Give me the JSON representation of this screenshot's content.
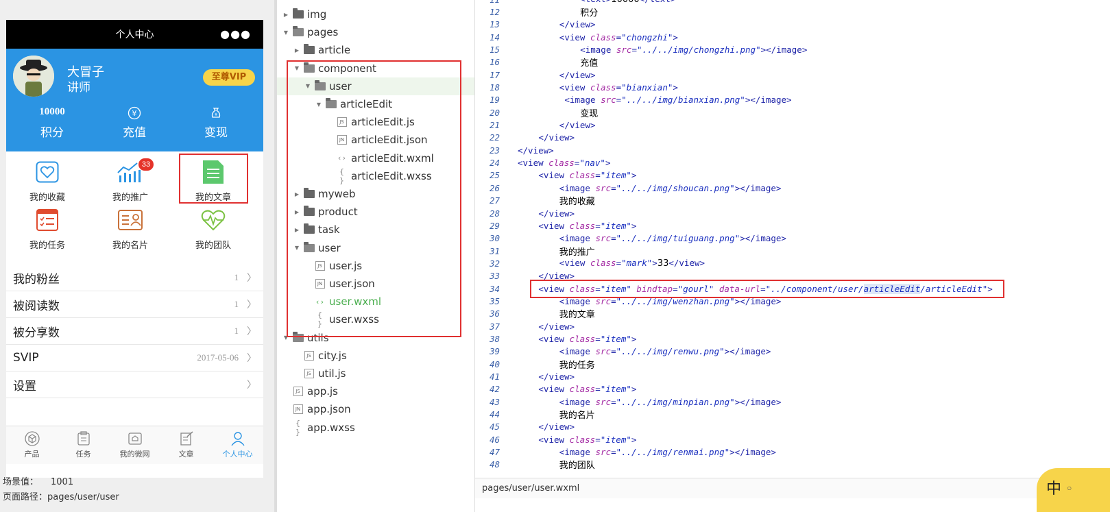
{
  "simulator": {
    "nav_title": "个人中心",
    "menu_dots": "●●●",
    "user": {
      "name": "大冒子",
      "role": "讲师",
      "vip_badge": "至尊VIP"
    },
    "stats": [
      {
        "value": "10000",
        "label": "积分",
        "icon": "points"
      },
      {
        "value": "",
        "label": "充值",
        "icon": "yen-circle-icon"
      },
      {
        "value": "",
        "label": "变现",
        "icon": "money-bag-icon"
      }
    ],
    "grid": [
      {
        "label": "我的收藏",
        "icon": "heart-icon"
      },
      {
        "label": "我的推广",
        "icon": "bar-chart-icon",
        "badge": "33"
      },
      {
        "label": "我的文章",
        "icon": "document-icon"
      },
      {
        "label": "我的任务",
        "icon": "checklist-icon"
      },
      {
        "label": "我的名片",
        "icon": "id-card-icon"
      },
      {
        "label": "我的团队",
        "icon": "heartbeat-icon"
      }
    ],
    "list": [
      {
        "label": "我的粉丝",
        "value": "1"
      },
      {
        "label": "被阅读数",
        "value": "1"
      },
      {
        "label": "被分享数",
        "value": "1"
      },
      {
        "label": "SVIP",
        "value": "2017-05-06"
      },
      {
        "label": "设置",
        "value": ""
      }
    ],
    "tabs": [
      {
        "label": "产品",
        "icon": "cube-icon"
      },
      {
        "label": "任务",
        "icon": "task-icon"
      },
      {
        "label": "我的微网",
        "icon": "home-icon"
      },
      {
        "label": "文章",
        "icon": "edit-doc-icon"
      },
      {
        "label": "个人中心",
        "icon": "person-icon",
        "active": true
      }
    ],
    "scene_label": "场景值：",
    "scene_value": "1001",
    "page_path": "页面路径：pages/user/user"
  },
  "tree": [
    {
      "name": "img",
      "type": "folder",
      "depth": 0,
      "open": false
    },
    {
      "name": "pages",
      "type": "folder",
      "depth": 0,
      "open": true
    },
    {
      "name": "article",
      "type": "folder",
      "depth": 1,
      "open": false
    },
    {
      "name": "component",
      "type": "folder",
      "depth": 1,
      "open": true
    },
    {
      "name": "user",
      "type": "folder",
      "depth": 2,
      "open": true,
      "selected": true
    },
    {
      "name": "articleEdit",
      "type": "folder",
      "depth": 3,
      "open": true
    },
    {
      "name": "articleEdit.js",
      "type": "js",
      "depth": 4
    },
    {
      "name": "articleEdit.json",
      "type": "json",
      "depth": 4
    },
    {
      "name": "articleEdit.wxml",
      "type": "wxml",
      "depth": 4
    },
    {
      "name": "articleEdit.wxss",
      "type": "wxss",
      "depth": 4
    },
    {
      "name": "myweb",
      "type": "folder",
      "depth": 1,
      "open": false
    },
    {
      "name": "product",
      "type": "folder",
      "depth": 1,
      "open": false
    },
    {
      "name": "task",
      "type": "folder",
      "depth": 1,
      "open": false
    },
    {
      "name": "user",
      "type": "folder",
      "depth": 1,
      "open": true
    },
    {
      "name": "user.js",
      "type": "js",
      "depth": 2
    },
    {
      "name": "user.json",
      "type": "json",
      "depth": 2
    },
    {
      "name": "user.wxml",
      "type": "wxml",
      "depth": 2,
      "active": true
    },
    {
      "name": "user.wxss",
      "type": "wxss",
      "depth": 2
    },
    {
      "name": "utils",
      "type": "folder",
      "depth": 0,
      "open": true
    },
    {
      "name": "city.js",
      "type": "js",
      "depth": 1
    },
    {
      "name": "util.js",
      "type": "js",
      "depth": 1
    },
    {
      "name": "app.js",
      "type": "js",
      "depth": 0
    },
    {
      "name": "app.json",
      "type": "json",
      "depth": 0
    },
    {
      "name": "app.wxss",
      "type": "wxss",
      "depth": 0
    }
  ],
  "editor": {
    "status_path": "pages/user/user.wxml",
    "lines": [
      {
        "n": "11",
        "indent": 12,
        "parts": [
          [
            "tag",
            "<text>"
          ],
          [
            "text",
            "10000"
          ],
          [
            "tag",
            "</text>"
          ]
        ]
      },
      {
        "n": "12",
        "indent": 12,
        "parts": [
          [
            "text",
            "积分"
          ]
        ]
      },
      {
        "n": "13",
        "indent": 8,
        "parts": [
          [
            "tag",
            "</view>"
          ]
        ]
      },
      {
        "n": "14",
        "indent": 8,
        "parts": [
          [
            "tag",
            "<view "
          ],
          [
            "attr",
            "class"
          ],
          [
            "tag",
            "="
          ],
          [
            "str",
            "\"chongzhi\""
          ],
          [
            "tag",
            ">"
          ]
        ]
      },
      {
        "n": "15",
        "indent": 12,
        "parts": [
          [
            "tag",
            "<image "
          ],
          [
            "attr",
            "src"
          ],
          [
            "tag",
            "="
          ],
          [
            "str",
            "\"../../img/chongzhi.png\""
          ],
          [
            "tag",
            "></image>"
          ]
        ]
      },
      {
        "n": "16",
        "indent": 12,
        "parts": [
          [
            "text",
            "充值"
          ]
        ]
      },
      {
        "n": "17",
        "indent": 8,
        "parts": [
          [
            "tag",
            "</view>"
          ]
        ]
      },
      {
        "n": "18",
        "indent": 8,
        "parts": [
          [
            "tag",
            "<view "
          ],
          [
            "attr",
            "class"
          ],
          [
            "tag",
            "="
          ],
          [
            "str",
            "\"bianxian\""
          ],
          [
            "tag",
            ">"
          ]
        ]
      },
      {
        "n": "19",
        "indent": 9,
        "parts": [
          [
            "tag",
            "<image "
          ],
          [
            "attr",
            "src"
          ],
          [
            "tag",
            "="
          ],
          [
            "str",
            "\"../../img/bianxian.png\""
          ],
          [
            "tag",
            "></image>"
          ]
        ]
      },
      {
        "n": "20",
        "indent": 12,
        "parts": [
          [
            "text",
            "变现"
          ]
        ]
      },
      {
        "n": "21",
        "indent": 8,
        "parts": [
          [
            "tag",
            "</view>"
          ]
        ]
      },
      {
        "n": "22",
        "indent": 4,
        "parts": [
          [
            "tag",
            "</view>"
          ]
        ]
      },
      {
        "n": "23",
        "indent": 0,
        "parts": [
          [
            "tag",
            "</view>"
          ]
        ]
      },
      {
        "n": "24",
        "indent": 0,
        "parts": [
          [
            "tag",
            "<view "
          ],
          [
            "attr",
            "class"
          ],
          [
            "tag",
            "="
          ],
          [
            "str",
            "\"nav\""
          ],
          [
            "tag",
            ">"
          ]
        ]
      },
      {
        "n": "25",
        "indent": 4,
        "parts": [
          [
            "tag",
            "<view "
          ],
          [
            "attr",
            "class"
          ],
          [
            "tag",
            "="
          ],
          [
            "str",
            "\"item\""
          ],
          [
            "tag",
            ">"
          ]
        ]
      },
      {
        "n": "26",
        "indent": 8,
        "parts": [
          [
            "tag",
            "<image "
          ],
          [
            "attr",
            "src"
          ],
          [
            "tag",
            "="
          ],
          [
            "str",
            "\"../../img/shoucan.png\""
          ],
          [
            "tag",
            "></image>"
          ]
        ]
      },
      {
        "n": "27",
        "indent": 8,
        "parts": [
          [
            "text",
            "我的收藏"
          ]
        ]
      },
      {
        "n": "28",
        "indent": 4,
        "parts": [
          [
            "tag",
            "</view>"
          ]
        ]
      },
      {
        "n": "29",
        "indent": 4,
        "parts": [
          [
            "tag",
            "<view "
          ],
          [
            "attr",
            "class"
          ],
          [
            "tag",
            "="
          ],
          [
            "str",
            "\"item\""
          ],
          [
            "tag",
            ">"
          ]
        ]
      },
      {
        "n": "30",
        "indent": 8,
        "parts": [
          [
            "tag",
            "<image "
          ],
          [
            "attr",
            "src"
          ],
          [
            "tag",
            "="
          ],
          [
            "str",
            "\"../../img/tuiguang.png\""
          ],
          [
            "tag",
            "></image>"
          ]
        ]
      },
      {
        "n": "31",
        "indent": 8,
        "parts": [
          [
            "text",
            "我的推广"
          ]
        ]
      },
      {
        "n": "32",
        "indent": 8,
        "parts": [
          [
            "tag",
            "<view "
          ],
          [
            "attr",
            "class"
          ],
          [
            "tag",
            "="
          ],
          [
            "str",
            "\"mark\""
          ],
          [
            "tag",
            ">"
          ],
          [
            "text",
            "33"
          ],
          [
            "tag",
            "</view>"
          ]
        ]
      },
      {
        "n": "33",
        "indent": 4,
        "parts": [
          [
            "tag",
            "</view>"
          ]
        ]
      },
      {
        "n": "34",
        "indent": 4,
        "parts": [
          [
            "tag",
            "<view "
          ],
          [
            "attr",
            "class"
          ],
          [
            "tag",
            "="
          ],
          [
            "str",
            "\"item\" "
          ],
          [
            "attr",
            "bindtap"
          ],
          [
            "tag",
            "="
          ],
          [
            "str",
            "\"gourl\" "
          ],
          [
            "attr",
            "data-url"
          ],
          [
            "tag",
            "="
          ],
          [
            "str",
            "\"../component/user/"
          ],
          [
            "hl",
            "articleEdit"
          ],
          [
            "str",
            "/articleEdit\""
          ],
          [
            "tag",
            ">"
          ]
        ]
      },
      {
        "n": "35",
        "indent": 8,
        "parts": [
          [
            "tag",
            "<image "
          ],
          [
            "attr",
            "src"
          ],
          [
            "tag",
            "="
          ],
          [
            "str",
            "\"../../img/wenzhan.png\""
          ],
          [
            "tag",
            "></image>"
          ]
        ]
      },
      {
        "n": "36",
        "indent": 8,
        "parts": [
          [
            "text",
            "我的文章"
          ]
        ]
      },
      {
        "n": "37",
        "indent": 4,
        "parts": [
          [
            "tag",
            "</view>"
          ]
        ]
      },
      {
        "n": "38",
        "indent": 4,
        "parts": [
          [
            "tag",
            "<view "
          ],
          [
            "attr",
            "class"
          ],
          [
            "tag",
            "="
          ],
          [
            "str",
            "\"item\""
          ],
          [
            "tag",
            ">"
          ]
        ]
      },
      {
        "n": "39",
        "indent": 8,
        "parts": [
          [
            "tag",
            "<image "
          ],
          [
            "attr",
            "src"
          ],
          [
            "tag",
            "="
          ],
          [
            "str",
            "\"../../img/renwu.png\""
          ],
          [
            "tag",
            "></image>"
          ]
        ]
      },
      {
        "n": "40",
        "indent": 8,
        "parts": [
          [
            "text",
            "我的任务"
          ]
        ]
      },
      {
        "n": "41",
        "indent": 4,
        "parts": [
          [
            "tag",
            "</view>"
          ]
        ]
      },
      {
        "n": "42",
        "indent": 4,
        "parts": [
          [
            "tag",
            "<view "
          ],
          [
            "attr",
            "class"
          ],
          [
            "tag",
            "="
          ],
          [
            "str",
            "\"item\""
          ],
          [
            "tag",
            ">"
          ]
        ]
      },
      {
        "n": "43",
        "indent": 8,
        "parts": [
          [
            "tag",
            "<image "
          ],
          [
            "attr",
            "src"
          ],
          [
            "tag",
            "="
          ],
          [
            "str",
            "\"../../img/minpian.png\""
          ],
          [
            "tag",
            "></image>"
          ]
        ]
      },
      {
        "n": "44",
        "indent": 8,
        "parts": [
          [
            "text",
            "我的名片"
          ]
        ]
      },
      {
        "n": "45",
        "indent": 4,
        "parts": [
          [
            "tag",
            "</view>"
          ]
        ]
      },
      {
        "n": "46",
        "indent": 4,
        "parts": [
          [
            "tag",
            "<view "
          ],
          [
            "attr",
            "class"
          ],
          [
            "tag",
            "="
          ],
          [
            "str",
            "\"item\""
          ],
          [
            "tag",
            ">"
          ]
        ]
      },
      {
        "n": "47",
        "indent": 8,
        "parts": [
          [
            "tag",
            "<image "
          ],
          [
            "attr",
            "src"
          ],
          [
            "tag",
            "="
          ],
          [
            "str",
            "\"../../img/renmai.png\""
          ],
          [
            "tag",
            "></image>"
          ]
        ]
      },
      {
        "n": "48",
        "indent": 8,
        "parts": [
          [
            "text",
            "我的团队"
          ]
        ]
      }
    ]
  },
  "ime": {
    "label": "中",
    "sub": "○"
  },
  "colors": {
    "accent_blue": "#2b94e3",
    "highlight_red": "#e03030",
    "vip_yellow": "#f7d44a",
    "badge_red": "#e5332a",
    "active_green": "#4caf50"
  }
}
